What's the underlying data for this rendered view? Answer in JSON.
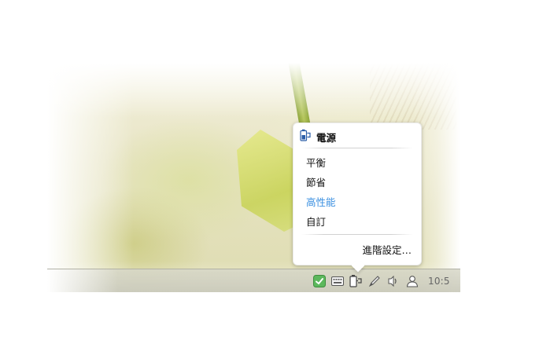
{
  "power_menu": {
    "title": "電源",
    "modes": [
      "平衡",
      "節省",
      "高性能",
      "自訂"
    ],
    "active_mode": "高性能",
    "advanced_label": "進階設定…"
  },
  "taskbar": {
    "clock": "10:5",
    "tray_icons": [
      "checkmark-icon",
      "keyboard-icon",
      "power-icon",
      "pen-icon",
      "volume-icon",
      "user-icon"
    ]
  },
  "colors": {
    "active_mode": "#3a8fe0",
    "tray_check": "#5cb85c"
  }
}
